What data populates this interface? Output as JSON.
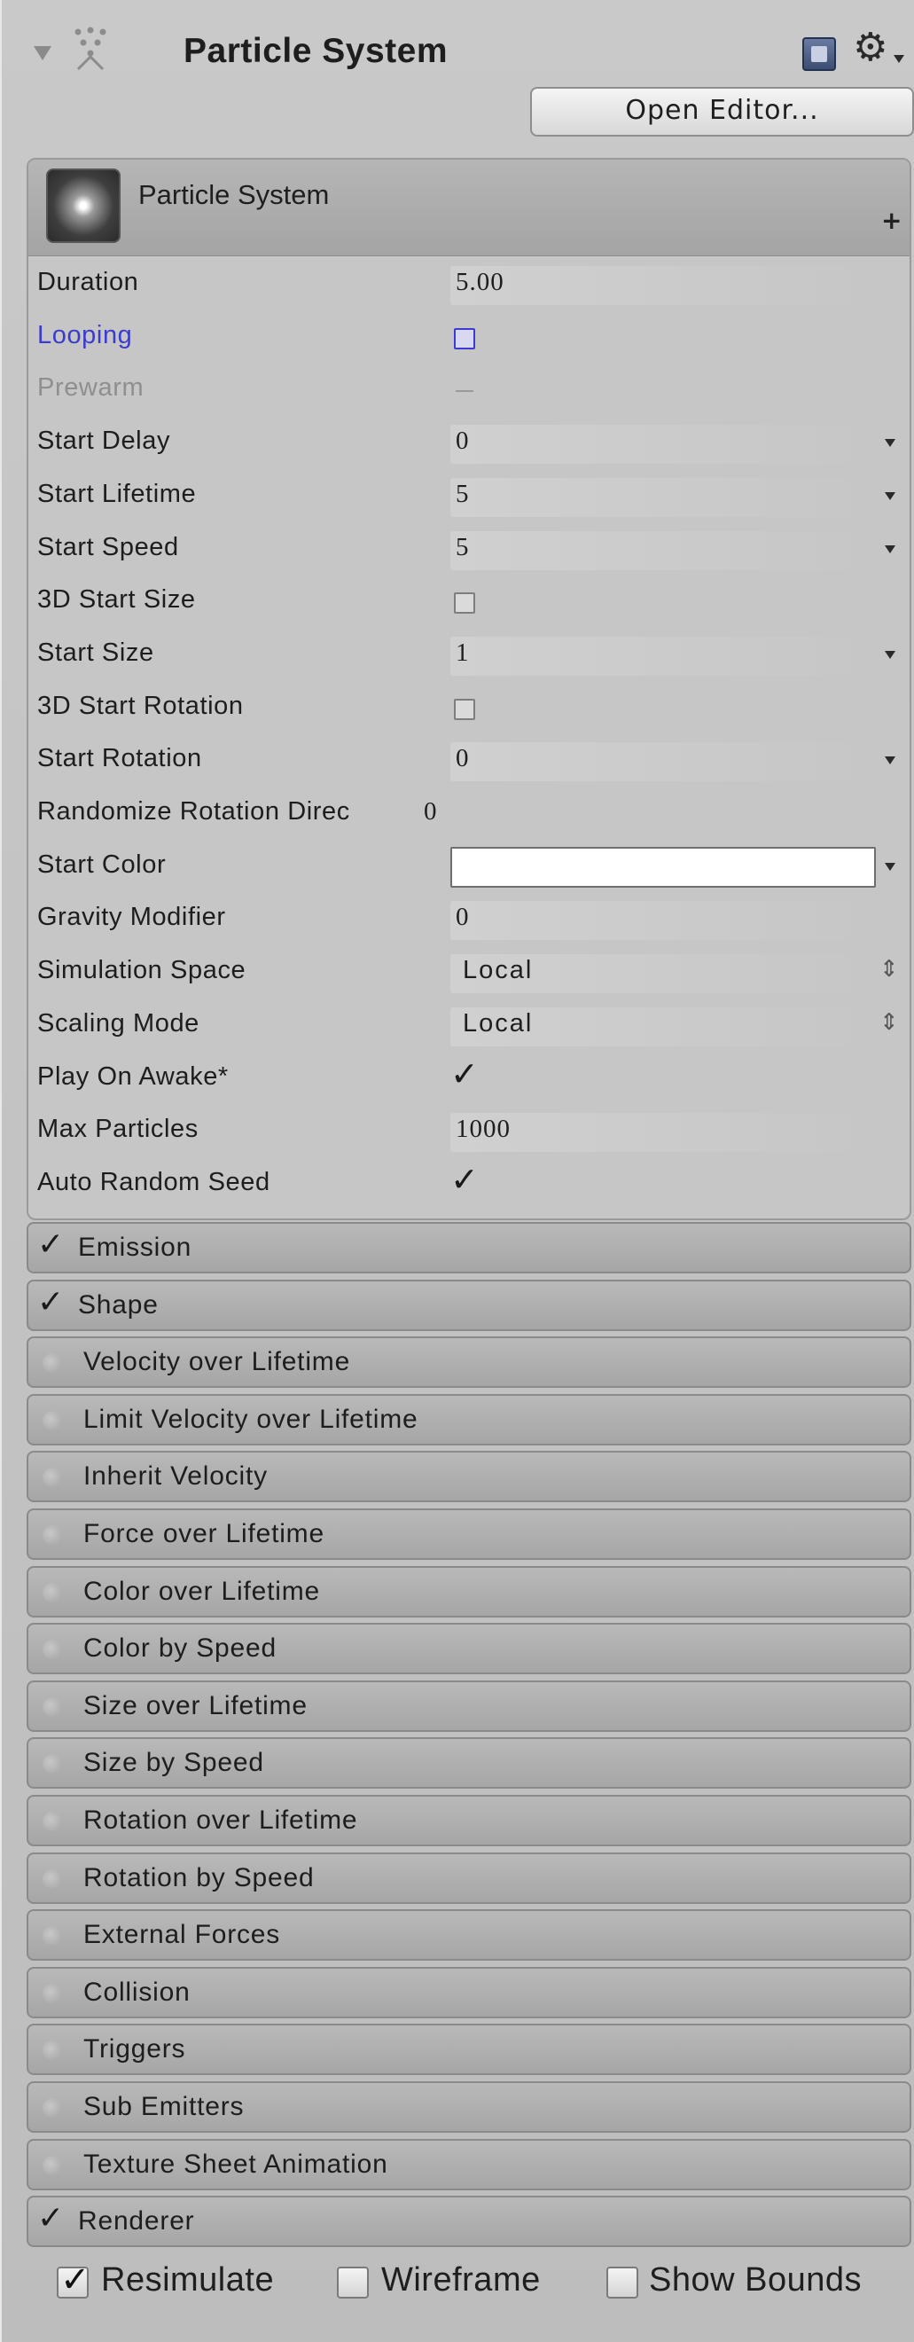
{
  "header": {
    "title": "Particle System",
    "open_editor_label": "Open Editor..."
  },
  "main_module": {
    "title": "Particle System",
    "properties": [
      {
        "label": "Duration",
        "value": "5.00",
        "kind": "field"
      },
      {
        "label": "Looping",
        "value": "",
        "kind": "checkbox-blue"
      },
      {
        "label": "Prewarm",
        "value": "",
        "kind": "mixed"
      },
      {
        "label": "Start Delay",
        "value": "0",
        "kind": "field-dropdown"
      },
      {
        "label": "Start Lifetime",
        "value": "5",
        "kind": "field-dropdown"
      },
      {
        "label": "Start Speed",
        "value": "5",
        "kind": "field-dropdown"
      },
      {
        "label": "3D Start Size",
        "value": "",
        "kind": "checkbox"
      },
      {
        "label": "Start Size",
        "value": "1",
        "kind": "field-dropdown"
      },
      {
        "label": "3D Start Rotation",
        "value": "",
        "kind": "checkbox"
      },
      {
        "label": "Start Rotation",
        "value": "0",
        "kind": "field-dropdown"
      },
      {
        "label": "Randomize Rotation Direc",
        "value": "0",
        "kind": "plain"
      },
      {
        "label": "Start Color",
        "value": "",
        "kind": "color"
      },
      {
        "label": "Gravity Modifier",
        "value": "0",
        "kind": "field"
      },
      {
        "label": "Simulation Space",
        "value": "Local",
        "kind": "select"
      },
      {
        "label": "Scaling Mode",
        "value": "Local",
        "kind": "select"
      },
      {
        "label": "Play On Awake*",
        "value": "",
        "kind": "checked"
      },
      {
        "label": "Max Particles",
        "value": "1000",
        "kind": "field"
      },
      {
        "label": "Auto Random Seed",
        "value": "",
        "kind": "checked"
      }
    ]
  },
  "modules": [
    {
      "label": "Emission",
      "enabled": true
    },
    {
      "label": "Shape",
      "enabled": true
    },
    {
      "label": "Velocity over Lifetime",
      "enabled": false
    },
    {
      "label": "Limit Velocity over Lifetime",
      "enabled": false
    },
    {
      "label": "Inherit Velocity",
      "enabled": false
    },
    {
      "label": "Force over Lifetime",
      "enabled": false
    },
    {
      "label": "Color over Lifetime",
      "enabled": false
    },
    {
      "label": "Color by Speed",
      "enabled": false
    },
    {
      "label": "Size over Lifetime",
      "enabled": false
    },
    {
      "label": "Size by Speed",
      "enabled": false
    },
    {
      "label": "Rotation over Lifetime",
      "enabled": false
    },
    {
      "label": "Rotation by Speed",
      "enabled": false
    },
    {
      "label": "External Forces",
      "enabled": false
    },
    {
      "label": "Collision",
      "enabled": false
    },
    {
      "label": "Triggers",
      "enabled": false
    },
    {
      "label": "Sub Emitters",
      "enabled": false
    },
    {
      "label": "Texture Sheet Animation",
      "enabled": false
    },
    {
      "label": "Renderer",
      "enabled": true
    }
  ],
  "footer": {
    "resimulate_label": "Resimulate",
    "resimulate_checked": true,
    "wireframe_label": "Wireframe",
    "wireframe_checked": false,
    "show_bounds_label": "Show Bounds",
    "show_bounds_checked": false
  },
  "colors": {
    "link_blue": "#3c3ccc",
    "start_color": "#ffffff"
  },
  "icons": [
    "fold-arrow-icon",
    "particle-system-icon",
    "help-icon",
    "gear-icon",
    "plus-icon",
    "checkmark-icon",
    "dropdown-arrow-icon",
    "updown-icon"
  ]
}
